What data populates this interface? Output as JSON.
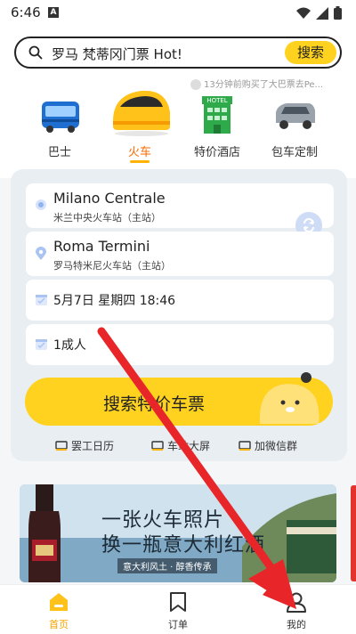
{
  "status_bar": {
    "time": "6:46",
    "a_badge": "A"
  },
  "search": {
    "query": "罗马 梵蒂冈门票 Hot!",
    "button_label": "搜索"
  },
  "ticker": {
    "text": "13分钟前购买了大巴票去Pe..."
  },
  "categories": [
    {
      "label": "巴士",
      "icon": "bus-icon"
    },
    {
      "label": "火车",
      "icon": "train-icon",
      "active": true
    },
    {
      "label": "特价酒店",
      "icon": "hotel-icon",
      "sign": "HOTEL"
    },
    {
      "label": "包车定制",
      "icon": "van-icon"
    }
  ],
  "form": {
    "from": {
      "name": "Milano Centrale",
      "sub": "米兰中央火车站（主站）"
    },
    "to": {
      "name": "Roma Termini",
      "sub": "罗马特米尼火车站（主站）"
    },
    "date": "5月7日 星期四 18:46",
    "passengers": "1成人",
    "search_button": "搜索特价车票"
  },
  "quick_links": [
    {
      "label": "罢工日历"
    },
    {
      "label": "车站大屏"
    },
    {
      "label": "加微信群"
    }
  ],
  "banner": {
    "line1": "一张火车照片",
    "line2": "换一瓶意大利红酒",
    "sub": "意大利风土 · 醇香传承"
  },
  "tabbar": [
    {
      "label": "首页",
      "active": true
    },
    {
      "label": "订单"
    },
    {
      "label": "我的"
    }
  ],
  "colors": {
    "accent": "#ffd21f",
    "active_tab": "#ff6a00",
    "arrow": "#e8262a"
  }
}
